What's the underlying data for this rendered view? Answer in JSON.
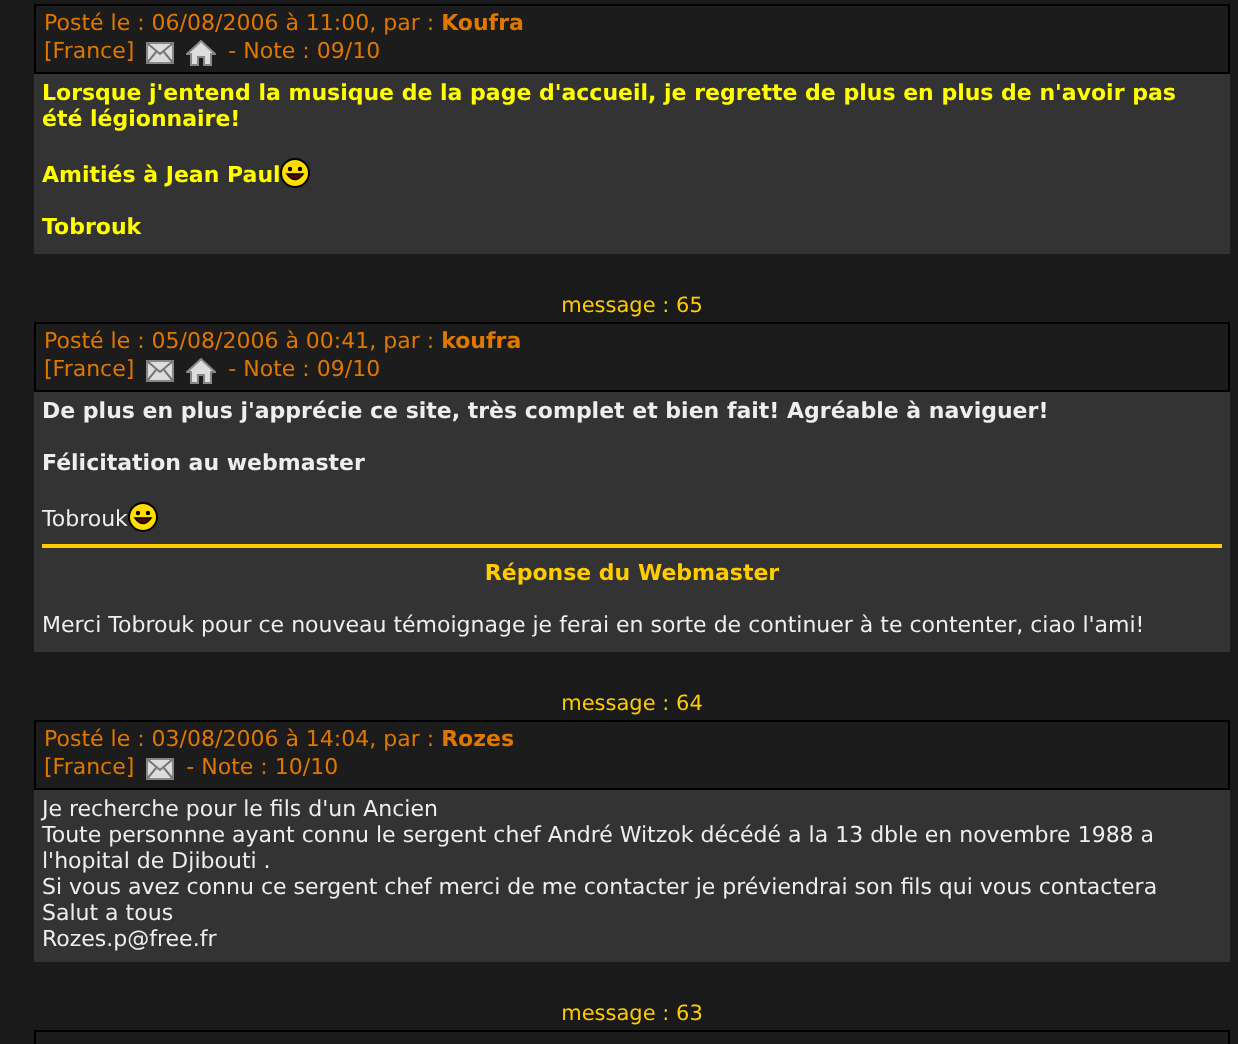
{
  "posts": [
    {
      "date": "Posté le : 06/08/2006 à 11:00, par :",
      "author": "Koufra",
      "country": "[France]",
      "email": true,
      "homepage": true,
      "note": "- Note : 09/10",
      "highlighted": true,
      "paragraphs": [
        {
          "text": "Lorsque j'entend la musique de la page d'accueil, je regrette de plus en plus de n'avoir pas été légionnaire!",
          "bold": true,
          "smiley": false
        },
        {
          "text": "Amitiés à Jean Paul",
          "bold": true,
          "smiley": true
        },
        {
          "text": "Tobrouk",
          "bold": true,
          "smiley": false
        }
      ]
    },
    {
      "message_number": "message : 65",
      "date": "Posté le : 05/08/2006 à 00:41, par :",
      "author": "koufra",
      "country": "[France]",
      "email": true,
      "homepage": true,
      "note": "- Note : 09/10",
      "highlighted": false,
      "paragraphs": [
        {
          "text": "De plus en plus j'apprécie ce site, très complet et bien fait! Agréable à naviguer!",
          "bold": true,
          "smiley": false
        },
        {
          "text": "Félicitation au webmaster",
          "bold": true,
          "smiley": false
        },
        {
          "text": "Tobrouk",
          "bold": false,
          "smiley": true
        }
      ],
      "reply": {
        "title": "Réponse du Webmaster",
        "text": "Merci Tobrouk pour ce nouveau témoignage je ferai en sorte de continuer à te contenter, ciao l'ami!"
      }
    },
    {
      "message_number": "message : 64",
      "date": "Posté le : 03/08/2006 à 14:04, par :",
      "author": "Rozes",
      "country": "[France]",
      "email": true,
      "homepage": false,
      "note": "- Note : 10/10",
      "highlighted": false,
      "lines": [
        "Je recherche pour le fils d'un Ancien",
        "Toute personnne ayant connu le sergent chef André Witzok décédé a la 13 dble en novembre 1988 a l'hopital de Djibouti .",
        "Si vous avez connu ce sergent chef merci de me contacter je préviendrai son fils qui vous contactera",
        "Salut a tous",
        "Rozes.p@free.fr"
      ]
    },
    {
      "message_number": "message : 63",
      "partial": true
    }
  ]
}
